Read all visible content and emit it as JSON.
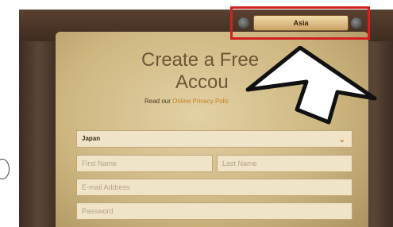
{
  "region_button": {
    "label": "Asia"
  },
  "heading": {
    "line1": "Create a Free",
    "line2": "Accou"
  },
  "privacy": {
    "prefix": "Read our",
    "link": "Online Privacy Polic"
  },
  "form": {
    "country_value": "Japan",
    "first_name_placeholder": "First Name",
    "last_name_placeholder": "Last Name",
    "email_placeholder": "E-mail Address",
    "password_placeholder": "Password"
  },
  "icons": {
    "chevron": "chevron-down-icon",
    "arrow": "pointer-arrow-icon",
    "bolt": "bolt-icon"
  },
  "colors": {
    "highlight": "#d32020",
    "link": "#c28220"
  }
}
